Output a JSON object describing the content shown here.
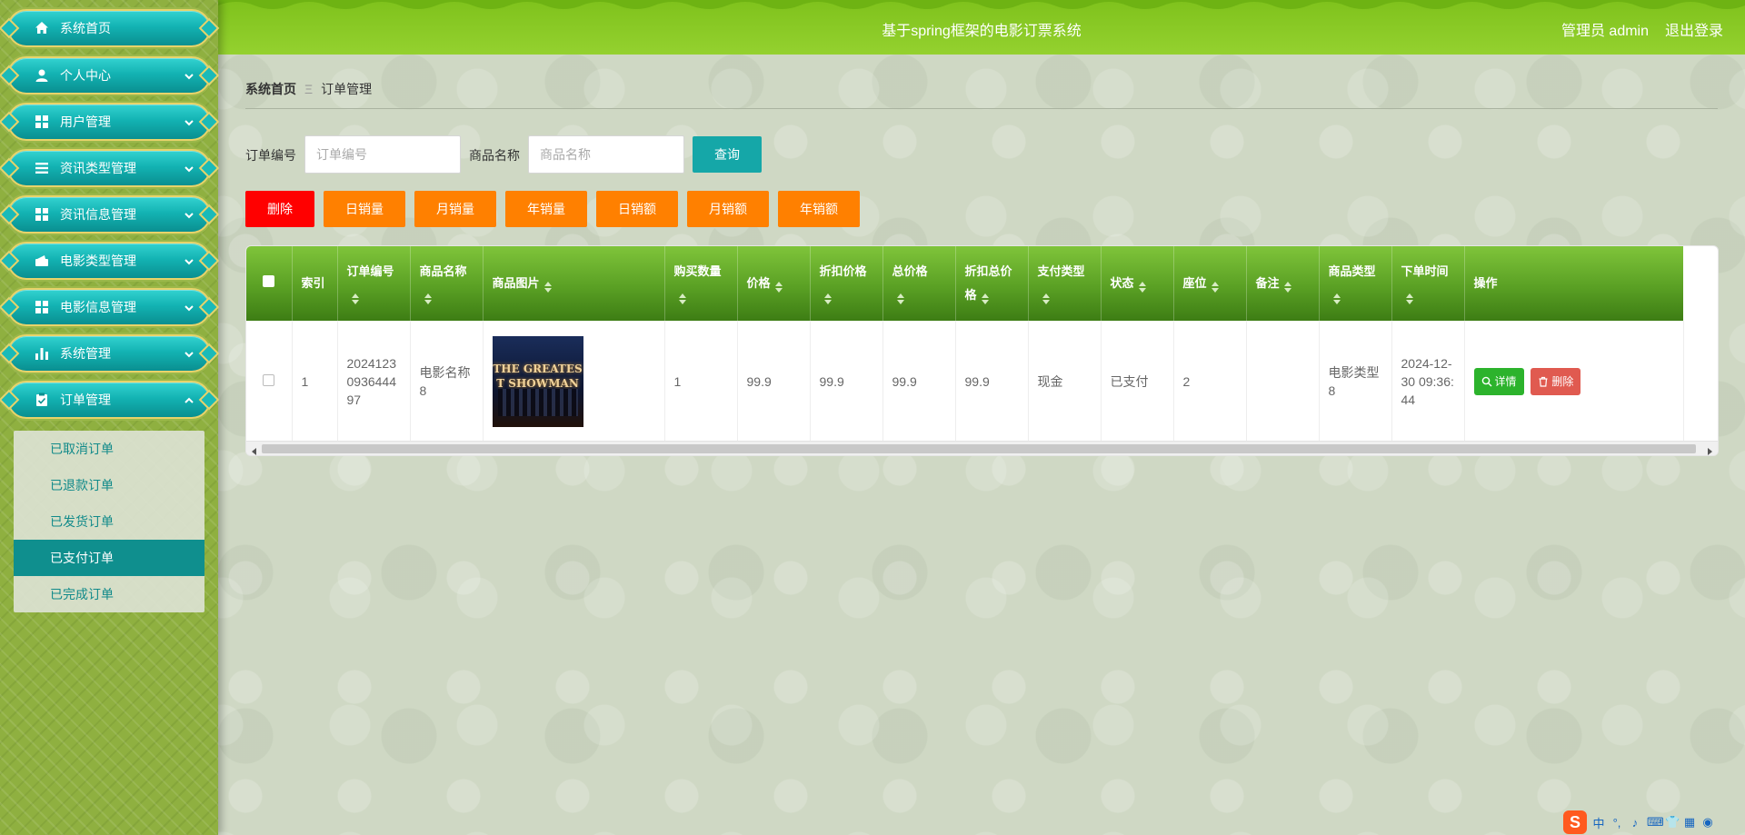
{
  "sidebar": {
    "items": [
      {
        "label": "系统首页",
        "icon": "home-icon"
      },
      {
        "label": "个人中心",
        "icon": "user-icon"
      },
      {
        "label": "用户管理",
        "icon": "grid-icon"
      },
      {
        "label": "资讯类型管理",
        "icon": "list-icon"
      },
      {
        "label": "资讯信息管理",
        "icon": "grid-icon"
      },
      {
        "label": "电影类型管理",
        "icon": "wallet-icon"
      },
      {
        "label": "电影信息管理",
        "icon": "grid-icon"
      },
      {
        "label": "系统管理",
        "icon": "bar-chart-icon"
      },
      {
        "label": "订单管理",
        "icon": "clipboard-icon"
      }
    ],
    "submenu": [
      {
        "label": "已取消订单"
      },
      {
        "label": "已退款订单"
      },
      {
        "label": "已发货订单"
      },
      {
        "label": "已支付订单",
        "active": true
      },
      {
        "label": "已完成订单"
      }
    ]
  },
  "header": {
    "title": "基于spring框架的电影订票系统",
    "user": "管理员 admin",
    "logout": "退出登录"
  },
  "breadcrumb": {
    "home": "系统首页",
    "separator": "Ξ",
    "current": "订单管理"
  },
  "search": {
    "order_no_label": "订单编号",
    "order_no_placeholder": "订单编号",
    "order_no_value": "",
    "product_label": "商品名称",
    "product_placeholder": "商品名称",
    "product_value": "",
    "query_button": "查询"
  },
  "actions": {
    "delete": "删除",
    "daily_volume": "日销量",
    "monthly_volume": "月销量",
    "yearly_volume": "年销量",
    "daily_sales": "日销额",
    "monthly_sales": "月销额",
    "yearly_sales": "年销额"
  },
  "table": {
    "headers": {
      "index": "索引",
      "order_no": "订单编号",
      "product_name": "商品名称",
      "product_image": "商品图片",
      "quantity": "购买数量",
      "price": "价格",
      "discount_price": "折扣价格",
      "total": "总价格",
      "discount_total": "折扣总价格",
      "pay_type": "支付类型",
      "status": "状态",
      "seat": "座位",
      "remark": "备注",
      "product_type": "商品类型",
      "order_time": "下单时间",
      "operation": "操作"
    },
    "rows": [
      {
        "index": "1",
        "order_no": "2024123093644497",
        "product_name": "电影名称8",
        "poster_title": "THE GREATEST SHOWMAN",
        "quantity": "1",
        "price": "99.9",
        "discount_price": "99.9",
        "total": "99.9",
        "discount_total": "99.9",
        "pay_type": "现金",
        "status": "已支付",
        "seat": "2",
        "remark": "",
        "product_type": "电影类型8",
        "order_time": "2024-12-30 09:36:44",
        "detail_button": "详情",
        "delete_button": "删除"
      }
    ]
  },
  "ime": {
    "logo": "S",
    "items": [
      "中",
      "°,",
      "♪",
      "⌨",
      "👕",
      "▦",
      "◉"
    ]
  },
  "colors": {
    "header": "#8bcb2a",
    "menu": "#13b3b3",
    "query": "#15a7a8",
    "danger": "#ff0000",
    "orange": "#ff8000",
    "table_header": "#5aa024"
  }
}
